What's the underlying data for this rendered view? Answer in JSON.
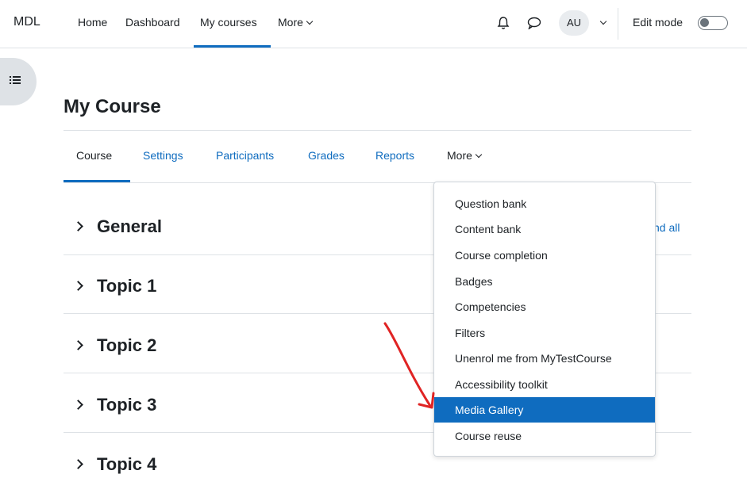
{
  "topnav": {
    "brand": "MDL",
    "items": [
      "Home",
      "Dashboard",
      "My courses",
      "More"
    ],
    "avatar_initials": "AU",
    "edit_mode_label": "Edit mode"
  },
  "course": {
    "title": "My Course",
    "tabs": [
      "Course",
      "Settings",
      "Participants",
      "Grades",
      "Reports",
      "More"
    ]
  },
  "sections": [
    "General",
    "Topic 1",
    "Topic 2",
    "Topic 3",
    "Topic 4"
  ],
  "expand_all_partial": "nd all",
  "dropdown": {
    "items": [
      "Question bank",
      "Content bank",
      "Course completion",
      "Badges",
      "Competencies",
      "Filters",
      "Unenrol me from MyTestCourse",
      "Accessibility toolkit",
      "Media Gallery",
      "Course reuse"
    ],
    "active_item": "Media Gallery"
  },
  "colors": {
    "accent": "#0f6cbf",
    "annotation_arrow": "#e02424",
    "text": "#1d2125"
  }
}
